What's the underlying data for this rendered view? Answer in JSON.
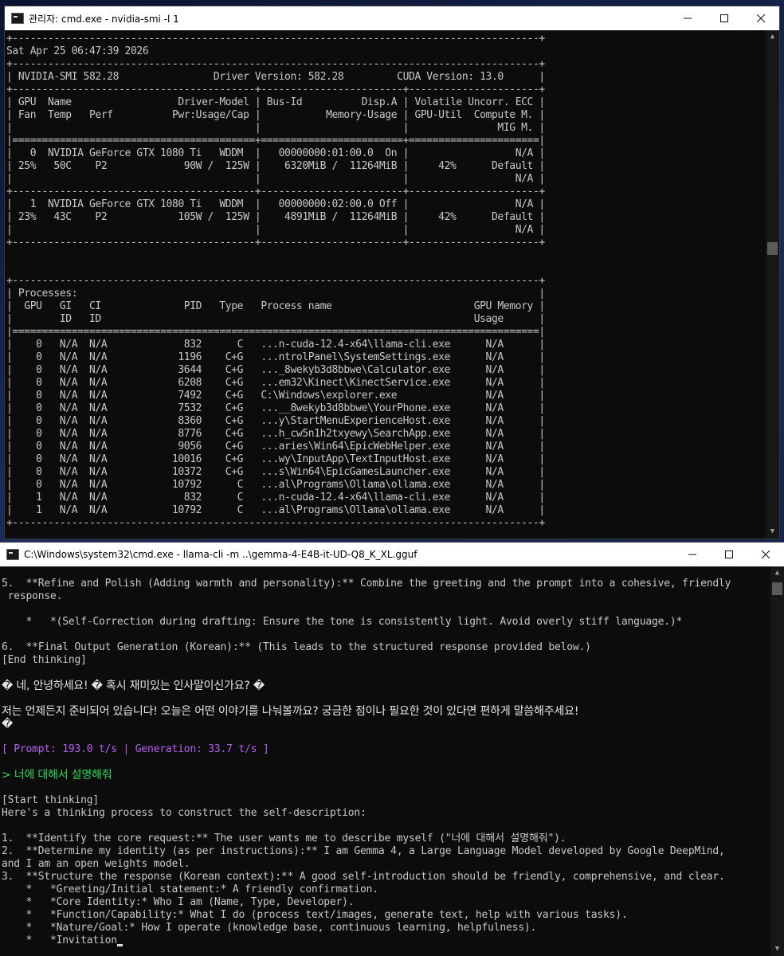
{
  "window1": {
    "title": "관리자: cmd.exe - nvidia-smi  -l 1",
    "lines": [
      "+-----------------------------------------------------------------------------------------+",
      "Sat Apr 25 06:47:39 2026",
      "+-----------------------------------------------------------------------------------------+",
      "| NVIDIA-SMI 582.28                Driver Version: 582.28         CUDA Version: 13.0      |",
      "+-----------------------------------------+------------------------+----------------------+",
      "| GPU  Name                  Driver-Model | Bus-Id          Disp.A | Volatile Uncorr. ECC |",
      "| Fan  Temp   Perf          Pwr:Usage/Cap |           Memory-Usage | GPU-Util  Compute M. |",
      "|                                         |                        |               MIG M. |",
      "|=========================================+========================+======================|",
      "|   0  NVIDIA GeForce GTX 1080 Ti   WDDM  |   00000000:01:00.0  On |                  N/A |",
      "| 25%   50C    P2             90W /  125W |    6320MiB /  11264MiB |     42%      Default |",
      "|                                         |                        |                  N/A |",
      "+-----------------------------------------+------------------------+----------------------+",
      "|   1  NVIDIA GeForce GTX 1080 Ti   WDDM  |   00000000:02:00.0 Off |                  N/A |",
      "| 23%   43C    P2            105W /  125W |    4891MiB /  11264MiB |     42%      Default |",
      "|                                         |                        |                  N/A |",
      "+-----------------------------------------+------------------------+----------------------+",
      "",
      "",
      "+-----------------------------------------------------------------------------------------+",
      "| Processes:                                                                              |",
      "|  GPU   GI   CI              PID   Type   Process name                        GPU Memory |",
      "|        ID   ID                                                               Usage      |",
      "|=========================================================================================|",
      "|    0   N/A  N/A             832      C   ...n-cuda-12.4-x64\\llama-cli.exe      N/A      |",
      "|    0   N/A  N/A            1196    C+G   ...ntrolPanel\\SystemSettings.exe      N/A      |",
      "|    0   N/A  N/A            3644    C+G   ..._8wekyb3d8bbwe\\Calculator.exe      N/A      |",
      "|    0   N/A  N/A            6208    C+G   ...em32\\Kinect\\KinectService.exe      N/A      |",
      "|    0   N/A  N/A            7492    C+G   C:\\Windows\\explorer.exe               N/A      |",
      "|    0   N/A  N/A            7532    C+G   ...__8wekyb3d8bbwe\\YourPhone.exe      N/A      |",
      "|    0   N/A  N/A            8360    C+G   ...y\\StartMenuExperienceHost.exe      N/A      |",
      "|    0   N/A  N/A            8776    C+G   ...h_cw5n1h2txyewy\\SearchApp.exe      N/A      |",
      "|    0   N/A  N/A            9056    C+G   ...aries\\Win64\\EpicWebHelper.exe      N/A      |",
      "|    0   N/A  N/A           10016    C+G   ...wy\\InputApp\\TextInputHost.exe      N/A      |",
      "|    0   N/A  N/A           10372    C+G   ...s\\Win64\\EpicGamesLauncher.exe      N/A      |",
      "|    0   N/A  N/A           10792      C   ...al\\Programs\\Ollama\\ollama.exe      N/A      |",
      "|    1   N/A  N/A             832      C   ...n-cuda-12.4-x64\\llama-cli.exe      N/A      |",
      "|    1   N/A  N/A           10792      C   ...al\\Programs\\Ollama\\ollama.exe      N/A      |",
      "+-----------------------------------------------------------------------------------------+"
    ]
  },
  "window2": {
    "title": "C:\\Windows\\system32\\cmd.exe - llama-cli  -m ..\\gemma-4-E4B-it-UD-Q8_K_XL.gguf",
    "lines": [
      {
        "text": "5.  **Refine and Polish (Adding warmth and personality):** Combine the greeting and the prompt into a cohesive, friendly",
        "style": "normal"
      },
      {
        "text": " response.",
        "style": "normal"
      },
      {
        "text": "",
        "style": "normal"
      },
      {
        "text": "    *   *(Self-Correction during drafting: Ensure the tone is consistently light. Avoid overly stiff language.)*",
        "style": "normal"
      },
      {
        "text": "",
        "style": "normal"
      },
      {
        "text": "6.  **Final Output Generation (Korean):** (This leads to the structured response provided below.)",
        "style": "normal"
      },
      {
        "text": "[End thinking]",
        "style": "normal"
      },
      {
        "text": "",
        "style": "normal"
      },
      {
        "text": "� 네, 안녕하세요! � 혹시 재미있는 인사말이신가요? �",
        "style": "kr"
      },
      {
        "text": "",
        "style": "normal"
      },
      {
        "text": "저는 언제든지 준비되어 있습니다! 오늘은 어떤 이야기를 나눠볼까요? 궁금한 점이나 필요한 것이 있다면 편하게 말씀해주세요!",
        "style": "kr"
      },
      {
        "text": "�",
        "style": "kr"
      },
      {
        "text": "",
        "style": "normal"
      },
      {
        "text": "[ Prompt: 193.0 t/s | Generation: 33.7 t/s ]",
        "style": "purple"
      },
      {
        "text": "",
        "style": "normal"
      },
      {
        "text": "> 너에 대해서 설명해줘",
        "style": "green"
      },
      {
        "text": "",
        "style": "normal"
      },
      {
        "text": "[Start thinking]",
        "style": "normal"
      },
      {
        "text": "Here's a thinking process to construct the self-description:",
        "style": "normal"
      },
      {
        "text": "",
        "style": "normal"
      },
      {
        "text": "1.  **Identify the core request:** The user wants me to describe myself (\"너에 대해서 설명해줘\").",
        "style": "normal"
      },
      {
        "text": "2.  **Determine my identity (as per instructions):** I am Gemma 4, a Large Language Model developed by Google DeepMind,",
        "style": "normal"
      },
      {
        "text": "and I am an open weights model.",
        "style": "normal"
      },
      {
        "text": "3.  **Structure the response (Korean context):** A good self-introduction should be friendly, comprehensive, and clear.",
        "style": "normal"
      },
      {
        "text": "    *   *Greeting/Initial statement:* A friendly confirmation.",
        "style": "normal"
      },
      {
        "text": "    *   *Core Identity:* Who I am (Name, Type, Developer).",
        "style": "normal"
      },
      {
        "text": "    *   *Function/Capability:* What I do (process text/images, generate text, help with various tasks).",
        "style": "normal"
      },
      {
        "text": "    *   *Nature/Goal:* How I operate (knowledge base, continuous learning, helpfulness).",
        "style": "normal"
      },
      {
        "text": "    *   *Invitation",
        "style": "cursor"
      }
    ]
  }
}
